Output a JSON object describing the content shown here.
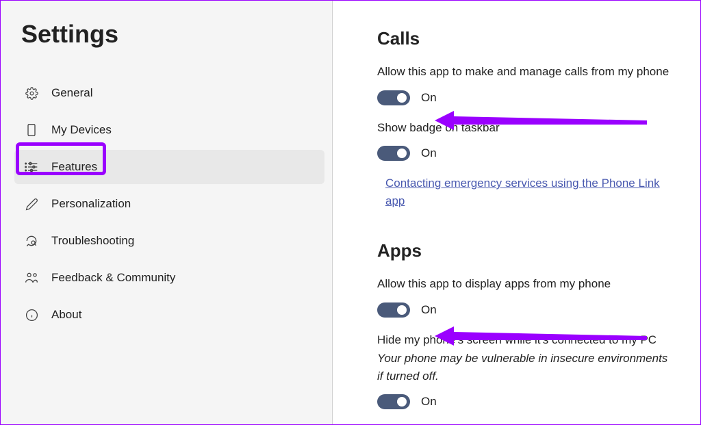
{
  "page_title": "Settings",
  "sidebar": {
    "items": [
      {
        "label": "General"
      },
      {
        "label": "My Devices"
      },
      {
        "label": "Features"
      },
      {
        "label": "Personalization"
      },
      {
        "label": "Troubleshooting"
      },
      {
        "label": "Feedback & Community"
      },
      {
        "label": "About"
      }
    ]
  },
  "sections": {
    "calls": {
      "title": "Calls",
      "desc": "Allow this app to make and manage calls from my phone",
      "toggle1_state": "On",
      "badge_desc": "Show badge on taskbar",
      "toggle2_state": "On",
      "link": "Contacting emergency services using the Phone Link app"
    },
    "apps": {
      "title": "Apps",
      "desc": "Allow this app to display apps from my phone",
      "toggle1_state": "On",
      "hide_desc": "Hide my phone's screen while it's connected to my PC",
      "hide_note": "Your phone may be vulnerable in insecure environments if turned off.",
      "toggle2_state": "On"
    }
  },
  "annotation": {
    "highlight_color": "#9a00ff"
  }
}
